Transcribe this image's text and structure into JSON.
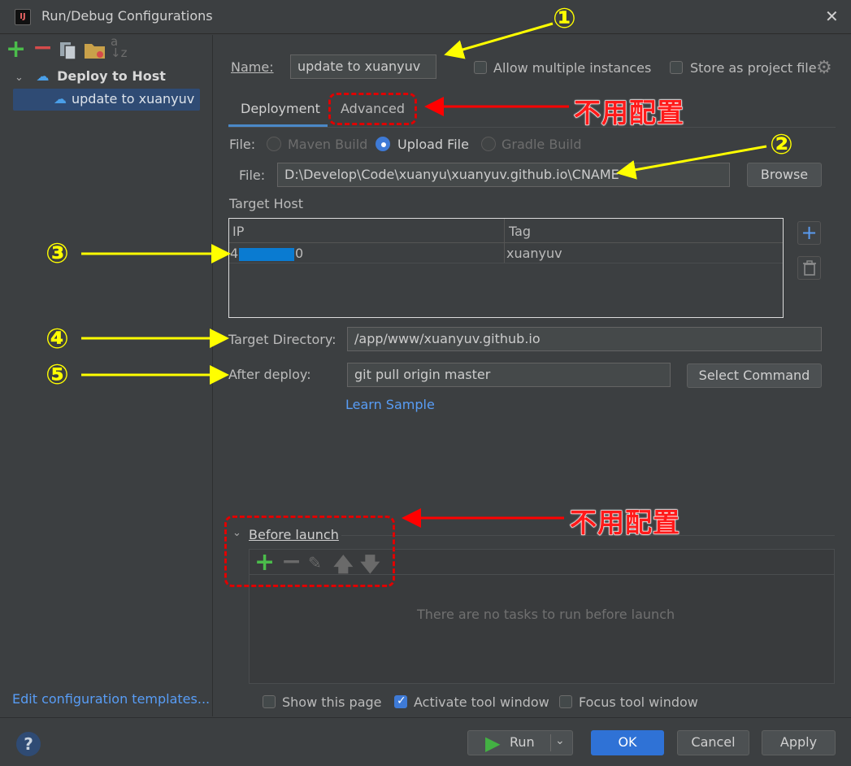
{
  "window": {
    "title": "Run/Debug Configurations",
    "app_icon": "IJ"
  },
  "sidebar": {
    "tree_group": "Deploy to Host",
    "tree_item": "update to xuanyuv",
    "sort_glyph_top": "a",
    "sort_glyph_bottom": "z",
    "edit_templates": "Edit configuration templates..."
  },
  "form": {
    "name_label": "Name:",
    "name_value": "update to xuanyuv",
    "allow_multiple": "Allow multiple instances",
    "store_as_project": "Store as project file",
    "tabs": [
      "Deployment",
      "Advanced"
    ],
    "file_label": "File:",
    "file_options": [
      "Maven Build",
      "Upload File",
      "Gradle Build"
    ],
    "file_path_label": "File:",
    "file_path": "D:\\Develop\\Code\\xuanyu\\xuanyuv.github.io\\CNAME",
    "browse": "Browse",
    "target_host": "Target Host",
    "table": {
      "headers": [
        "IP",
        "Tag"
      ],
      "rows": [
        {
          "ip_prefix": "4",
          "ip_suffix": "0",
          "tag": "xuanyuv"
        }
      ]
    },
    "target_dir_label": "Target Directory:",
    "target_dir_value": "/app/www/xuanyuv.github.io",
    "after_deploy_label": "After deploy:",
    "after_deploy_value": "git pull origin master",
    "select_command": "Select Command",
    "learn_sample": "Learn Sample"
  },
  "before_launch": {
    "title": "Before launch",
    "empty_text": "There are no tasks to run before launch",
    "show_page": "Show this page",
    "activate_tool": "Activate tool window",
    "focus_tool": "Focus tool window"
  },
  "buttons": {
    "help": "?",
    "run": "Run",
    "ok": "OK",
    "cancel": "Cancel",
    "apply": "Apply"
  },
  "annotations": {
    "no_config_1": "不用配置",
    "no_config_2": "不用配置",
    "markers": [
      "①",
      "②",
      "③",
      "④",
      "⑤"
    ]
  },
  "colors": {
    "accent": "#4a88c7",
    "annotation_red": "#ff0000",
    "annotation_yellow": "#ffff00",
    "ok_button": "#2f72d6"
  }
}
